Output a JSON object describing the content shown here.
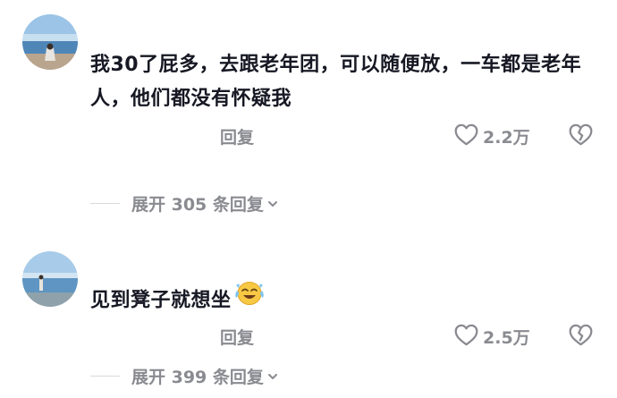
{
  "comments": [
    {
      "text": "我30了屁多，去跟老年团，可以随便放，一车都是老年人，他们都没有怀疑我",
      "reply_label": "回复",
      "likes": "2.2万",
      "expand_label": "展开 305 条回复"
    },
    {
      "text": "见到凳子就想坐",
      "reply_label": "回复",
      "likes": "2.5万",
      "expand_label": "展开 399 条回复"
    }
  ],
  "icons": {
    "like": "heart-outline-icon",
    "dislike": "broken-heart-icon",
    "expand": "chevron-down-icon",
    "emoji": "crying-laughing-emoji"
  },
  "colors": {
    "text": "#161823",
    "secondary": "#8a8b91"
  }
}
